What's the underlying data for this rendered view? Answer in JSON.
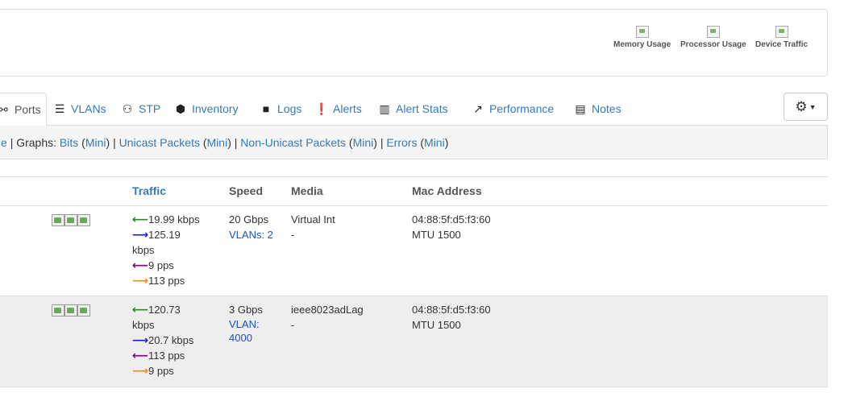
{
  "top_graphs": [
    {
      "label": "Memory Usage",
      "icon": "broken-image-icon"
    },
    {
      "label": "Processor Usage",
      "icon": "broken-image-icon"
    },
    {
      "label": "Device Traffic",
      "icon": "broken-image-icon"
    }
  ],
  "tabs": [
    {
      "label": "Ports",
      "icon": "ports-icon",
      "active": true
    },
    {
      "label": "VLANs",
      "icon": "vlans-icon"
    },
    {
      "label": "STP",
      "icon": "stp-icon"
    },
    {
      "label": "Inventory",
      "icon": "cube-icon"
    },
    {
      "label": "Logs",
      "icon": "note-icon"
    },
    {
      "label": "Alerts",
      "icon": "exclamation-icon"
    },
    {
      "label": "Alert Stats",
      "icon": "bar-chart-icon"
    },
    {
      "label": "Performance",
      "icon": "line-chart-icon"
    },
    {
      "label": "Notes",
      "icon": "file-text-icon"
    }
  ],
  "settings_button": {
    "icon": "gear-icon",
    "caret": "caret-down-icon"
  },
  "graphs_bar": {
    "prefix_fragment": "e",
    "graphs_label": "Graphs:",
    "bits": "Bits",
    "unicast": "Unicast Packets",
    "non_unicast": "Non-Unicast Packets",
    "errors": "Errors",
    "mini": "Mini"
  },
  "table": {
    "headers": {
      "traffic": "Traffic",
      "speed": "Speed",
      "media": "Media",
      "mac": "Mac Address"
    },
    "rows": [
      {
        "traffic_in": "19.99 kbps",
        "traffic_out_line1": "125.19",
        "traffic_out_line2": "kbps",
        "pps_in": "9 pps",
        "pps_out": "113 pps",
        "speed": "20 Gbps",
        "vlan_line1": "VLANs: 2",
        "vlan_line2": "",
        "media": "Virtual Int",
        "media_sub": "-",
        "mac": "04:88:5f:d5:f3:60",
        "mtu": "MTU 1500"
      },
      {
        "traffic_in_line1": "120.73",
        "traffic_in_line2": "kbps",
        "traffic_out": "20.7 kbps",
        "pps_in": "113 pps",
        "pps_out": "9 pps",
        "speed": "3 Gbps",
        "vlan_line1": "VLAN:",
        "vlan_line2": "4000",
        "media": "ieee8023adLag",
        "media_sub": "-",
        "mac": "04:88:5f:d5:f3:60",
        "mtu": "MTU 1500"
      }
    ]
  }
}
